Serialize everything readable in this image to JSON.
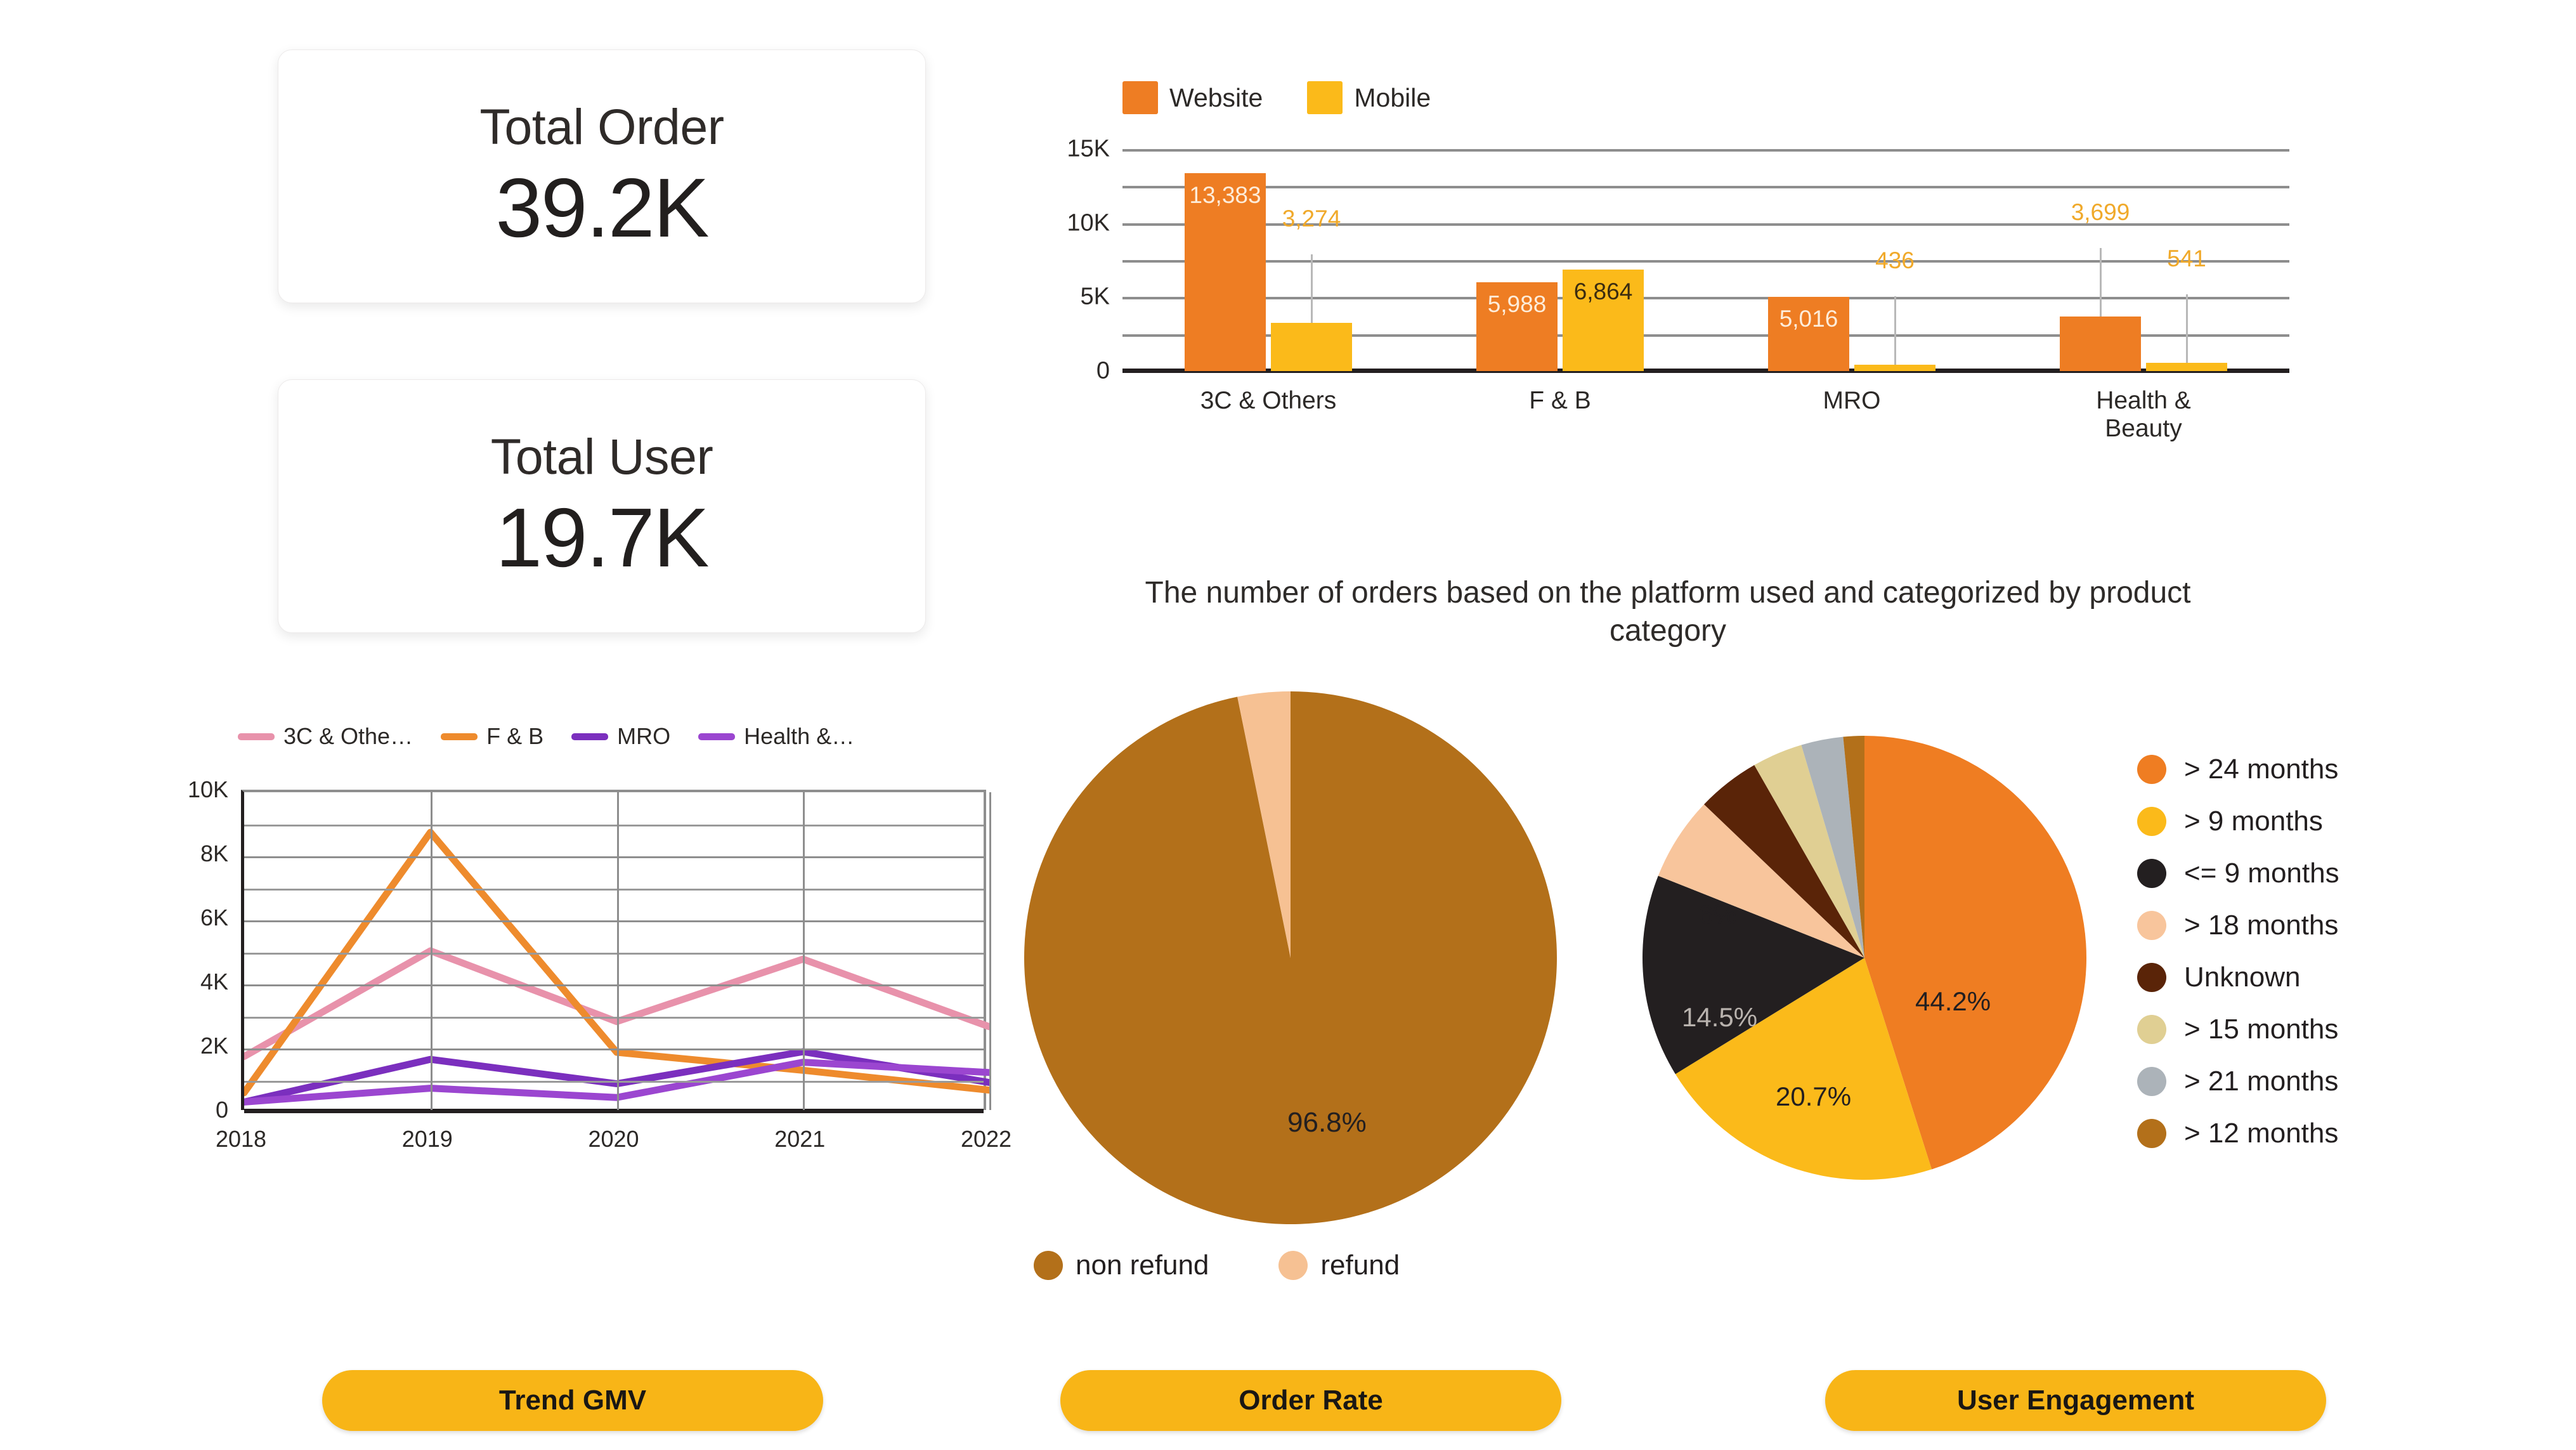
{
  "kpis": [
    {
      "title": "Total Order",
      "value": "39.2K"
    },
    {
      "title": "Total User",
      "value": "19.7K"
    }
  ],
  "bar_panel": {
    "caption": "The number of orders based on the platform used and categorized by product category"
  },
  "buttons": {
    "trend": "Trend GMV",
    "order": "Order Rate",
    "engagement": "User Engagement"
  },
  "colors": {
    "website_orange": "#ee7d23",
    "mobile_yellow": "#fbba1a",
    "pink": "#e892ab",
    "orange_line": "#ee8b2d",
    "mro_purple": "#7b2fbe",
    "health_purple": "#9b46d0",
    "non_refund_brown": "#b3701a",
    "refund_peach": "#f6c193",
    "button_amber": "#f8b517"
  },
  "chart_data": [
    {
      "type": "bar",
      "title": "",
      "subtitle": "The number of orders based on the platform used and categorized by product category",
      "categories": [
        "3C & Others",
        "F & B",
        "MRO",
        "Health & Beauty"
      ],
      "series": [
        {
          "name": "Website",
          "color": "#ee7d23",
          "values": [
            13383,
            5988,
            5016,
            3699
          ],
          "labels": [
            "13,383",
            "5,988",
            "5,016",
            "3,699"
          ]
        },
        {
          "name": "Mobile",
          "color": "#fbba1a",
          "values": [
            3274,
            6864,
            436,
            541
          ],
          "labels": [
            "3,274",
            "6,864",
            "436",
            "541"
          ]
        }
      ],
      "xlabel": "",
      "ylabel": "",
      "ylim": [
        0,
        15000
      ],
      "yticks": [
        0,
        5000,
        10000,
        15000
      ],
      "ytick_labels": [
        "0",
        "5K",
        "10K",
        "15K"
      ],
      "grid": true,
      "legend_position": "top-left"
    },
    {
      "type": "line",
      "title": "",
      "x": [
        "2018",
        "2019",
        "2020",
        "2021",
        "2022"
      ],
      "series": [
        {
          "name": "3C & Othe…",
          "color": "#e892ab",
          "values": [
            1750,
            5050,
            2840,
            4790,
            2680
          ]
        },
        {
          "name": "F & B",
          "color": "#ee8b2d",
          "values": [
            620,
            8750,
            1880,
            1320,
            700
          ]
        },
        {
          "name": "MRO",
          "color": "#7b2fbe",
          "values": [
            330,
            1660,
            900,
            1900,
            940
          ]
        },
        {
          "name": "Health &…",
          "color": "#9b46d0",
          "values": [
            330,
            760,
            470,
            1570,
            1250
          ]
        }
      ],
      "xlabel": "",
      "ylabel": "",
      "ylim": [
        0,
        10000
      ],
      "yticks": [
        0,
        2000,
        4000,
        6000,
        8000,
        10000
      ],
      "ytick_labels": [
        "0",
        "2K",
        "4K",
        "6K",
        "8K",
        "10K"
      ],
      "grid": true,
      "legend_position": "top"
    },
    {
      "type": "pie",
      "title": "",
      "labels": [
        "non refund",
        "refund"
      ],
      "values": [
        96.8,
        3.2
      ],
      "value_labels": [
        "96.8%",
        ""
      ],
      "colors": [
        "#b3701a",
        "#f6c193"
      ],
      "legend_position": "bottom"
    },
    {
      "type": "pie",
      "title": "",
      "labels": [
        "> 24 months",
        "> 9 months",
        "<= 9 months",
        "> 18 months",
        "Unknown",
        "> 15 months",
        "> 21 months",
        "> 12 months"
      ],
      "values": [
        44.2,
        20.7,
        14.5,
        6.0,
        4.5,
        3.6,
        3.0,
        1.5
      ],
      "value_labels": [
        "44.2%",
        "20.7%",
        "14.5%",
        "6%",
        "",
        "",
        "",
        ""
      ],
      "colors": [
        "#ef7d22",
        "#fbba1a",
        "#231f20",
        "#f8c59c",
        "#5a2408",
        "#e0cf93",
        "#acb3b9",
        "#b3701a"
      ],
      "legend_position": "right"
    }
  ]
}
